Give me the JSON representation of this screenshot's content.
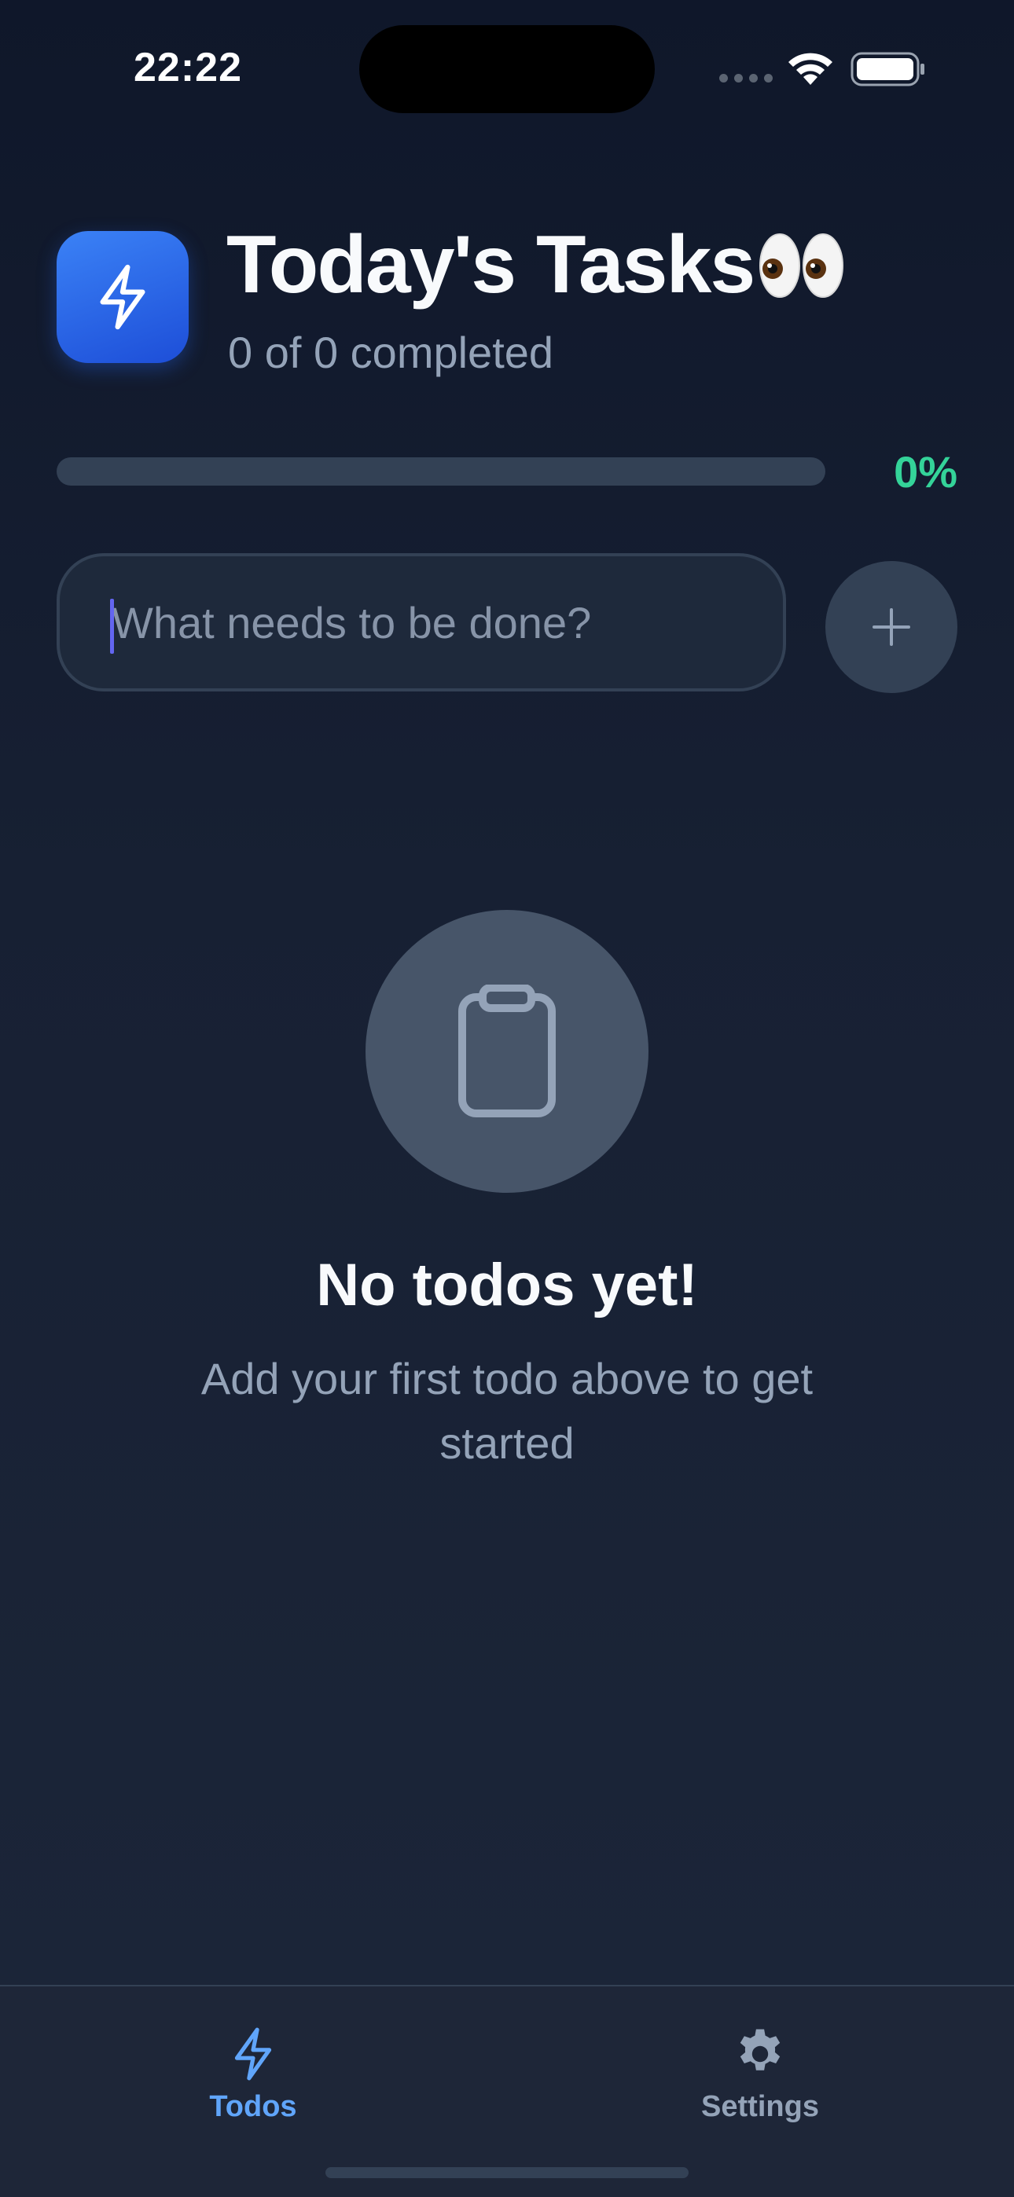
{
  "status_bar": {
    "time": "22:22"
  },
  "header": {
    "title": "Today's Tasks",
    "title_emoji": "eyes-emoji",
    "subtitle": "0 of 0 completed"
  },
  "progress": {
    "value": 0,
    "label": "0%"
  },
  "new_todo": {
    "placeholder": "What needs to be done?",
    "value": ""
  },
  "empty_state": {
    "icon": "clipboard-icon",
    "title": "No todos yet!",
    "description": "Add your first todo above to get started"
  },
  "tabs": [
    {
      "label": "Todos",
      "icon": "lightning-icon",
      "active": true
    },
    {
      "label": "Settings",
      "icon": "gear-icon",
      "active": false
    }
  ],
  "colors": {
    "accent": "#3b82f6",
    "progress": "#34d399",
    "background": "#0f172a",
    "tab_active": "#60a5fa",
    "tab_inactive": "#94a3b8"
  }
}
